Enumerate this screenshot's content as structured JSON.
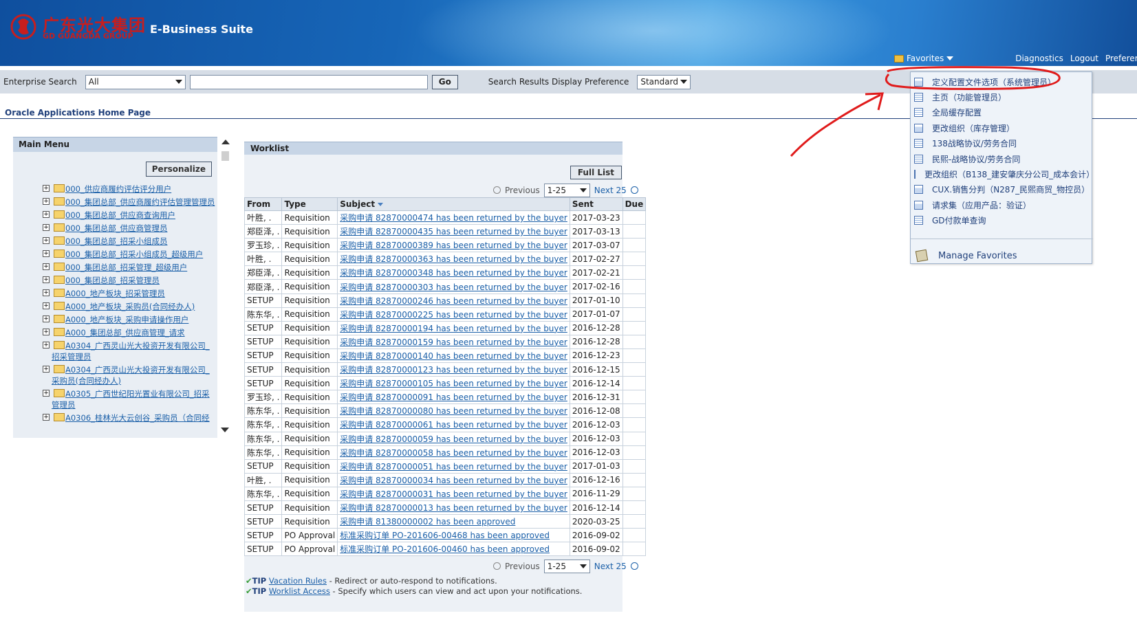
{
  "header": {
    "logo_cn": "广东光大集团",
    "logo_en": "GD GUANGDA GROUP",
    "suite_title": "E-Business Suite",
    "favorites_label": "Favorites",
    "links": [
      "Diagnostics",
      "Logout",
      "Preferer"
    ]
  },
  "search": {
    "label": "Enterprise Search",
    "scope": "All",
    "go_label": "Go",
    "pref_label": "Search Results Display Preference",
    "pref_value": "Standard"
  },
  "page_title": "Oracle Applications Home Page",
  "main_menu": {
    "title": "Main Menu",
    "personalize_label": "Personalize",
    "items": [
      "000_供应商履约评估评分用户",
      "000_集团总部_供应商履约评估管理管理员",
      "000_集团总部_供应商查询用户",
      "000_集团总部_供应商管理员",
      "000_集团总部_招采小组成员",
      "000_集团总部_招采小组成员_超级用户",
      "000_集团总部_招采管理_超级用户",
      "000_集团总部_招采管理员",
      "A000_地产板块_招采管理员",
      "A000_地产板块_采购员(合同经办人)",
      "A000_地产板块_采购申请操作用户",
      "A000_集团总部_供应商管理_请求",
      "A0304_广西灵山光大投资开发有限公司_招采管理员",
      "A0304_广西灵山光大投资开发有限公司_采购员(合同经办人)",
      "A0305_广西世纪阳光置业有限公司_招采管理员",
      "A0306_桂林光大云创谷_采购员（合同经"
    ]
  },
  "worklist": {
    "title": "Worklist",
    "full_list_label": "Full List",
    "previous_label": "Previous",
    "range": "1-25",
    "next_label": "Next 25",
    "columns": [
      "From",
      "Type",
      "Subject",
      "Sent",
      "Due"
    ],
    "rows": [
      {
        "from": "叶胜, .",
        "type": "Requisition",
        "subject": "采购申请 82870000474 has been returned by the buyer",
        "sent": "2017-03-23",
        "due": ""
      },
      {
        "from": "郑臣泽, .",
        "type": "Requisition",
        "subject": "采购申请 82870000435 has been returned by the buyer",
        "sent": "2017-03-13",
        "due": ""
      },
      {
        "from": "罗玉珍, .",
        "type": "Requisition",
        "subject": "采购申请 82870000389 has been returned by the buyer",
        "sent": "2017-03-07",
        "due": ""
      },
      {
        "from": "叶胜, .",
        "type": "Requisition",
        "subject": "采购申请 82870000363 has been returned by the buyer",
        "sent": "2017-02-27",
        "due": ""
      },
      {
        "from": "郑臣泽, .",
        "type": "Requisition",
        "subject": "采购申请 82870000348 has been returned by the buyer",
        "sent": "2017-02-21",
        "due": ""
      },
      {
        "from": "郑臣泽, .",
        "type": "Requisition",
        "subject": "采购申请 82870000303 has been returned by the buyer",
        "sent": "2017-02-16",
        "due": ""
      },
      {
        "from": "SETUP",
        "type": "Requisition",
        "subject": "采购申请 82870000246 has been returned by the buyer",
        "sent": "2017-01-10",
        "due": ""
      },
      {
        "from": "陈东华, .",
        "type": "Requisition",
        "subject": "采购申请 82870000225 has been returned by the buyer",
        "sent": "2017-01-07",
        "due": ""
      },
      {
        "from": "SETUP",
        "type": "Requisition",
        "subject": "采购申请 82870000194 has been returned by the buyer",
        "sent": "2016-12-28",
        "due": ""
      },
      {
        "from": "SETUP",
        "type": "Requisition",
        "subject": "采购申请 82870000159 has been returned by the buyer",
        "sent": "2016-12-28",
        "due": ""
      },
      {
        "from": "SETUP",
        "type": "Requisition",
        "subject": "采购申请 82870000140 has been returned by the buyer",
        "sent": "2016-12-23",
        "due": ""
      },
      {
        "from": "SETUP",
        "type": "Requisition",
        "subject": "采购申请 82870000123 has been returned by the buyer",
        "sent": "2016-12-15",
        "due": ""
      },
      {
        "from": "SETUP",
        "type": "Requisition",
        "subject": "采购申请 82870000105 has been returned by the buyer",
        "sent": "2016-12-14",
        "due": ""
      },
      {
        "from": "罗玉珍, .",
        "type": "Requisition",
        "subject": "采购申请 82870000091 has been returned by the buyer",
        "sent": "2016-12-31",
        "due": ""
      },
      {
        "from": "陈东华, .",
        "type": "Requisition",
        "subject": "采购申请 82870000080 has been returned by the buyer",
        "sent": "2016-12-08",
        "due": ""
      },
      {
        "from": "陈东华, .",
        "type": "Requisition",
        "subject": "采购申请 82870000061 has been returned by the buyer",
        "sent": "2016-12-03",
        "due": ""
      },
      {
        "from": "陈东华, .",
        "type": "Requisition",
        "subject": "采购申请 82870000059 has been returned by the buyer",
        "sent": "2016-12-03",
        "due": ""
      },
      {
        "from": "陈东华, .",
        "type": "Requisition",
        "subject": "采购申请 82870000058 has been returned by the buyer",
        "sent": "2016-12-03",
        "due": ""
      },
      {
        "from": "SETUP",
        "type": "Requisition",
        "subject": "采购申请 82870000051 has been returned by the buyer",
        "sent": "2017-01-03",
        "due": ""
      },
      {
        "from": "叶胜, .",
        "type": "Requisition",
        "subject": "采购申请 82870000034 has been returned by the buyer",
        "sent": "2016-12-16",
        "due": ""
      },
      {
        "from": "陈东华, .",
        "type": "Requisition",
        "subject": "采购申请 82870000031 has been returned by the buyer",
        "sent": "2016-11-29",
        "due": ""
      },
      {
        "from": "SETUP",
        "type": "Requisition",
        "subject": "采购申请 82870000013 has been returned by the buyer",
        "sent": "2016-12-14",
        "due": ""
      },
      {
        "from": "SETUP",
        "type": "Requisition",
        "subject": "采购申请 81380000002 has been approved",
        "sent": "2020-03-25",
        "due": ""
      },
      {
        "from": "SETUP",
        "type": "PO Approval",
        "subject": "标准采购订单 PO-201606-00468 has been approved",
        "sent": "2016-09-02",
        "due": ""
      },
      {
        "from": "SETUP",
        "type": "PO Approval",
        "subject": "标准采购订单 PO-201606-00460 has been approved",
        "sent": "2016-09-02",
        "due": ""
      }
    ]
  },
  "tips": [
    {
      "label": "TIP",
      "link": "Vacation Rules",
      "text": " - Redirect or auto-respond to notifications."
    },
    {
      "label": "TIP",
      "link": "Worklist Access",
      "text": " - Specify which users can view and act upon your notifications."
    }
  ],
  "favorites_menu": {
    "items": [
      {
        "label": "定义配置文件选项（系统管理员）",
        "icon": "form-icon"
      },
      {
        "label": "主页（功能管理员）",
        "icon": "page-icon"
      },
      {
        "label": "全局缓存配置",
        "icon": "page-icon"
      },
      {
        "label": "更改组织（库存管理）",
        "icon": "form-icon"
      },
      {
        "label": "138战略协议/劳务合同",
        "icon": "page-icon"
      },
      {
        "label": "民熙-战略协议/劳务合同",
        "icon": "page-icon"
      },
      {
        "label": "更改组织（B138_建安肇庆分公司_成本会计）",
        "icon": "form-icon"
      },
      {
        "label": "CUX.销售分判（N287_民熙商贸_物控员）",
        "icon": "form-icon"
      },
      {
        "label": "请求集（应用产品：验证）",
        "icon": "form-icon"
      },
      {
        "label": "GD付款单查询",
        "icon": "page-icon"
      }
    ],
    "manage_label": "Manage Favorites"
  },
  "colors": {
    "banner_dark": "#0f4f9e",
    "banner_light": "#3b9be0",
    "link": "#1a5fa8",
    "annotation_red": "#e01b1b"
  }
}
